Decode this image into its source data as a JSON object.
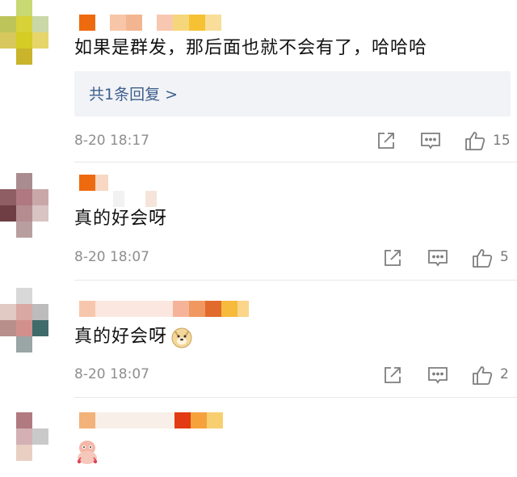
{
  "comments": [
    {
      "text": "如果是群发，那后面也就不会有了，哈哈哈",
      "reply_link": "共1条回复 >",
      "timestamp": "8-20 18:17",
      "likes": "15"
    },
    {
      "text": "真的好会呀",
      "timestamp": "8-20 18:07",
      "likes": "5"
    },
    {
      "text": "真的好会呀",
      "timestamp": "8-20 18:07",
      "likes": "2"
    },
    {
      "text": ""
    }
  ],
  "icons": {
    "share": "share-icon",
    "comment": "comment-icon",
    "like": "thumbs-up-icon",
    "emoji": "doge-emoji-icon",
    "sticker": "sticker-icon"
  },
  "colors": {
    "reply_link": "#3d5e8c",
    "meta_text": "#8e8e8e",
    "reply_bg": "#f1f3f6",
    "name_orange": "#ee6a0f"
  }
}
